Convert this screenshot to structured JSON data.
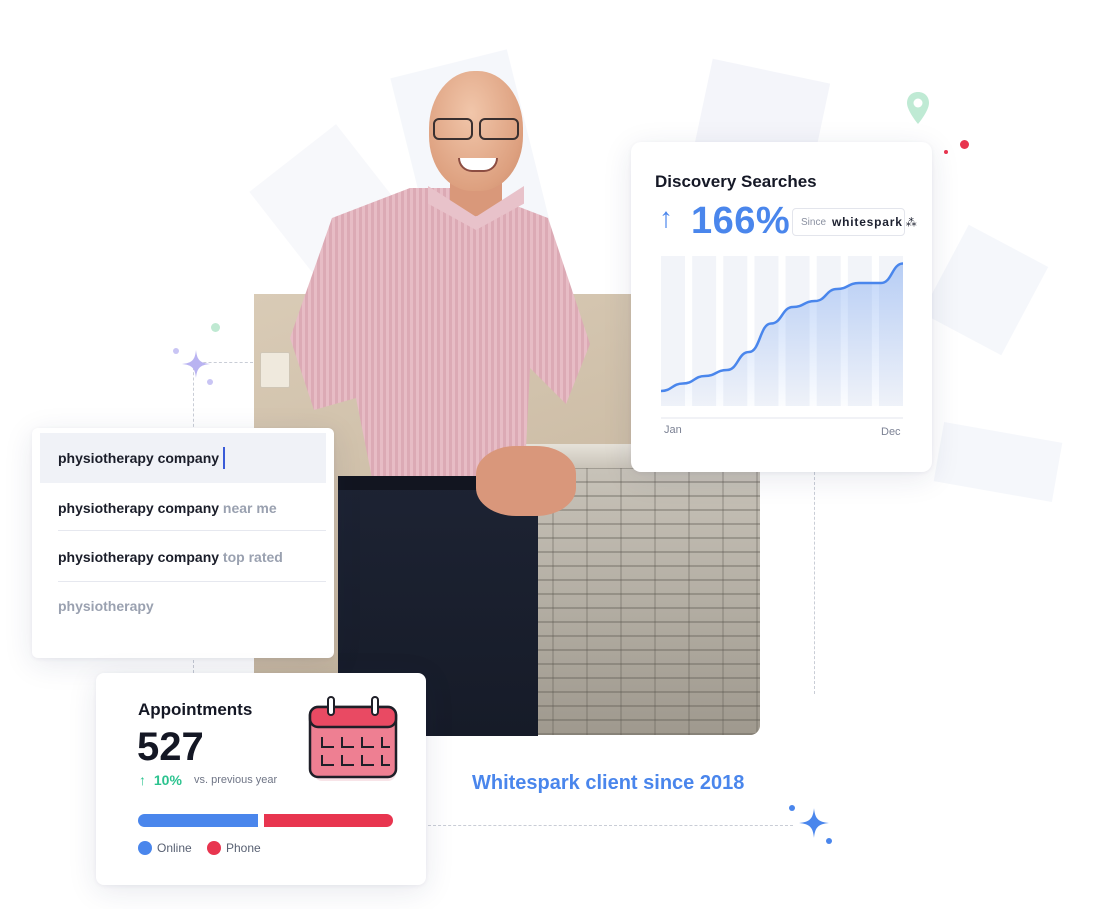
{
  "search_panel": {
    "suggestions": [
      {
        "query": "physiotherapy company",
        "completion": ""
      },
      {
        "query": "physiotherapy company",
        "completion": " near me"
      },
      {
        "query": "physiotherapy company",
        "completion": " top rated"
      },
      {
        "query": "",
        "completion": "physiotherapy"
      }
    ]
  },
  "discovery_card": {
    "title": "Discovery Searches",
    "arrow": "↑",
    "percent": "166%",
    "since_label": "Since",
    "brand": "whitespark",
    "chart_data": {
      "type": "area",
      "x_start_label": "Jan",
      "x_end_label": "Dec",
      "bars": 8,
      "y_values": [
        10,
        15,
        20,
        24,
        36,
        55,
        66,
        70,
        78,
        82,
        82,
        95
      ]
    },
    "colors": {
      "accent": "#4a86ec"
    }
  },
  "appointments_card": {
    "title": "Appointments",
    "count": "527",
    "change_arrow": "↑",
    "change_value": "10%",
    "change_label": "vs. previous year",
    "online_share": 0.48,
    "phone_share": 0.52,
    "legend": [
      {
        "label": "Online",
        "color": "#4a86ec"
      },
      {
        "label": "Phone",
        "color": "#e8354f"
      }
    ],
    "icon": "calendar-icon"
  },
  "caption": {
    "client_since": "Whitespark client since 2018"
  },
  "icons": [
    "map-pin-icon",
    "sparkle-icon",
    "sparkle-icon"
  ]
}
